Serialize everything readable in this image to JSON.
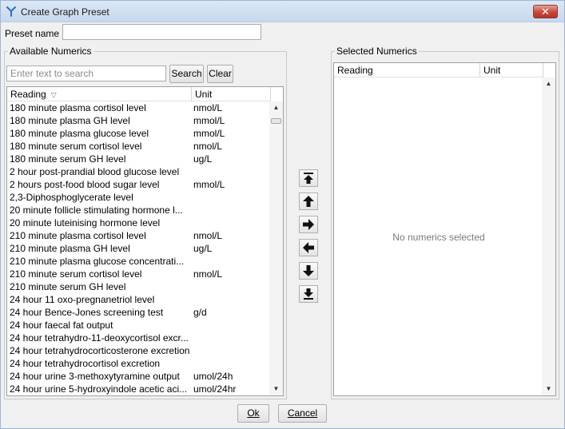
{
  "window": {
    "title": "Create Graph Preset"
  },
  "preset": {
    "label": "Preset name",
    "value": ""
  },
  "available": {
    "group_title": "Available Numerics",
    "search_placeholder": "Enter text to search",
    "search_label": "Search",
    "clear_label": "Clear",
    "columns": {
      "reading": "Reading",
      "unit": "Unit"
    },
    "rows": [
      {
        "reading": "180 minute plasma cortisol level",
        "unit": "nmol/L"
      },
      {
        "reading": "180 minute plasma GH level",
        "unit": "mmol/L"
      },
      {
        "reading": "180 minute plasma glucose level",
        "unit": "mmol/L"
      },
      {
        "reading": "180 minute serum cortisol level",
        "unit": "nmol/L"
      },
      {
        "reading": "180 minute serum GH level",
        "unit": "ug/L"
      },
      {
        "reading": "2 hour post-prandial blood glucose level",
        "unit": ""
      },
      {
        "reading": "2 hours post-food blood sugar level",
        "unit": "mmol/L"
      },
      {
        "reading": "2,3-Diphosphoglycerate level",
        "unit": ""
      },
      {
        "reading": "20 minute follicle stimulating hormone l...",
        "unit": ""
      },
      {
        "reading": "20 minute luteinising hormone level",
        "unit": ""
      },
      {
        "reading": "210 minute plasma cortisol level",
        "unit": "nmol/L"
      },
      {
        "reading": "210 minute plasma GH level",
        "unit": "ug/L"
      },
      {
        "reading": "210 minute plasma glucose concentrati...",
        "unit": ""
      },
      {
        "reading": "210 minute serum cortisol level",
        "unit": "nmol/L"
      },
      {
        "reading": "210 minute serum GH level",
        "unit": ""
      },
      {
        "reading": "24 hour 11 oxo-pregnanetriol level",
        "unit": ""
      },
      {
        "reading": "24 hour Bence-Jones screening test",
        "unit": "g/d"
      },
      {
        "reading": "24 hour faecal fat output",
        "unit": ""
      },
      {
        "reading": "24 hour tetrahydro-11-deoxycortisol excr...",
        "unit": ""
      },
      {
        "reading": "24 hour tetrahydrocorticosterone excretion",
        "unit": ""
      },
      {
        "reading": "24 hour tetrahydrocortisol excretion",
        "unit": ""
      },
      {
        "reading": "24 hour urine 3-methoxytyramine output",
        "unit": "umol/24h"
      },
      {
        "reading": "24 hour urine 5-hydroxyindole acetic aci...",
        "unit": "umol/24hr"
      }
    ]
  },
  "selected": {
    "group_title": "Selected Numerics",
    "columns": {
      "reading": "Reading",
      "unit": "Unit"
    },
    "empty_message": "No numerics selected"
  },
  "footer": {
    "ok_label": "Ok",
    "cancel_label": "Cancel"
  },
  "icons": {
    "app": "app-logo-icon",
    "close": "close-icon",
    "move_top": "move-to-top-icon",
    "move_up": "move-up-icon",
    "add": "add-right-icon",
    "remove": "remove-left-icon",
    "move_down": "move-down-icon",
    "move_bottom": "move-to-bottom-icon"
  }
}
